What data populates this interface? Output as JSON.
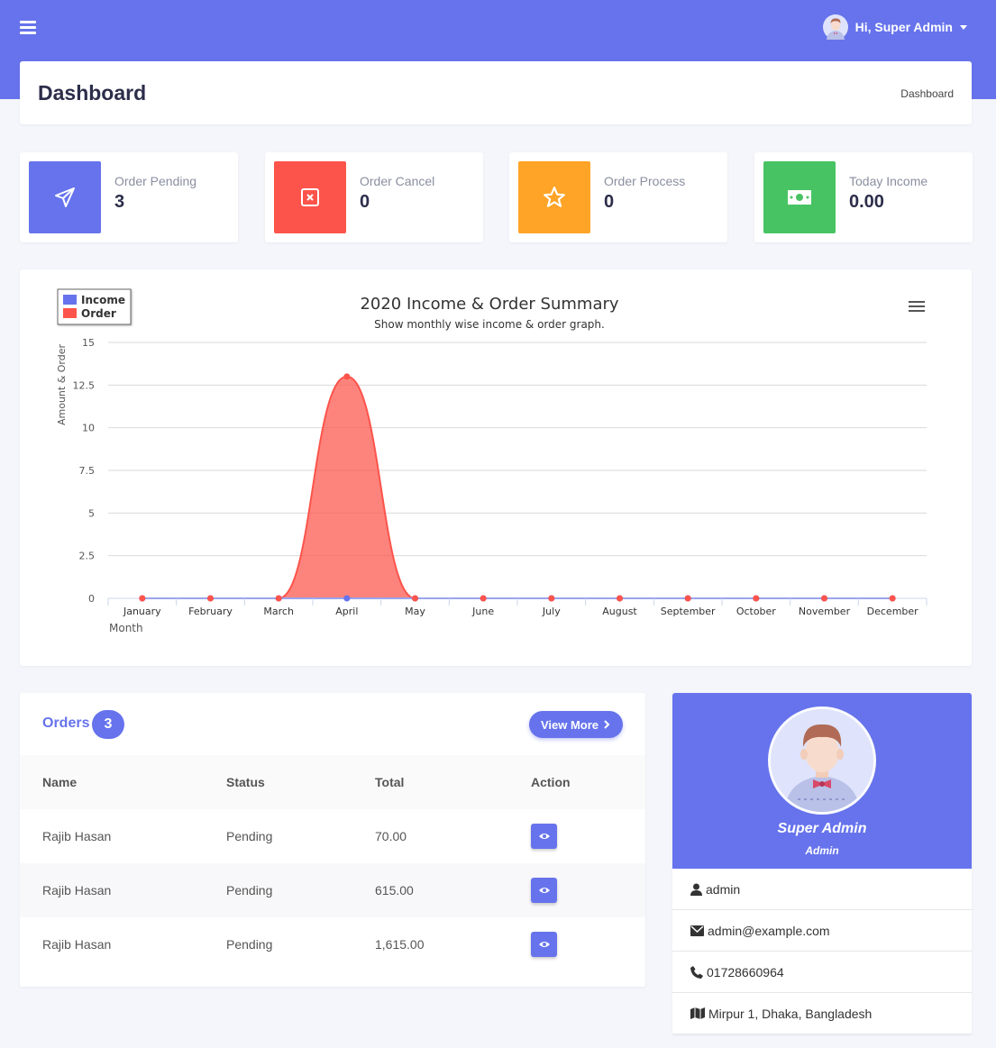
{
  "topbar": {
    "user_greeting": "Hi, Super Admin"
  },
  "header": {
    "title": "Dashboard",
    "breadcrumb": "Dashboard"
  },
  "stats": [
    {
      "label": "Order Pending",
      "value": "3",
      "icon": "paper-plane-icon",
      "color": "#6673ec"
    },
    {
      "label": "Order Cancel",
      "value": "0",
      "icon": "close-square-icon",
      "color": "#fc544b"
    },
    {
      "label": "Order Process",
      "value": "0",
      "icon": "star-icon",
      "color": "#ffa426"
    },
    {
      "label": "Today Income",
      "value": "0.00",
      "icon": "money-icon",
      "color": "#47c363"
    }
  ],
  "chart_data": {
    "type": "area",
    "title": "2020 Income & Order Summary",
    "subtitle": "Show monthly wise income & order graph.",
    "xlabel": "Month",
    "ylabel": "Amount & Order",
    "categories": [
      "January",
      "February",
      "March",
      "April",
      "May",
      "June",
      "July",
      "August",
      "September",
      "October",
      "November",
      "December"
    ],
    "ylim": [
      0,
      15
    ],
    "yticks": [
      "0",
      "2.5",
      "5",
      "7.5",
      "10",
      "12.5",
      "15"
    ],
    "grid": true,
    "legend_position": "top-left",
    "series": [
      {
        "name": "Income",
        "color": "#6673ec",
        "values": [
          0,
          0,
          0,
          0,
          0,
          0,
          0,
          0,
          0,
          0,
          0,
          0
        ]
      },
      {
        "name": "Order",
        "color": "#fc544b",
        "values": [
          0,
          0,
          0,
          13,
          0,
          0,
          0,
          0,
          0,
          0,
          0,
          0
        ]
      }
    ]
  },
  "orders": {
    "title": "Orders",
    "count": "3",
    "view_more": "View More",
    "columns": [
      "Name",
      "Status",
      "Total",
      "Action"
    ],
    "rows": [
      {
        "name": "Rajib Hasan",
        "status": "Pending",
        "total": "70.00"
      },
      {
        "name": "Rajib Hasan",
        "status": "Pending",
        "total": "615.00"
      },
      {
        "name": "Rajib Hasan",
        "status": "Pending",
        "total": "1,615.00"
      }
    ]
  },
  "profile": {
    "name": "Super Admin",
    "role": "Admin",
    "username": "admin",
    "email": "admin@example.com",
    "phone": "01728660964",
    "address": "Mirpur 1, Dhaka, Bangladesh"
  }
}
